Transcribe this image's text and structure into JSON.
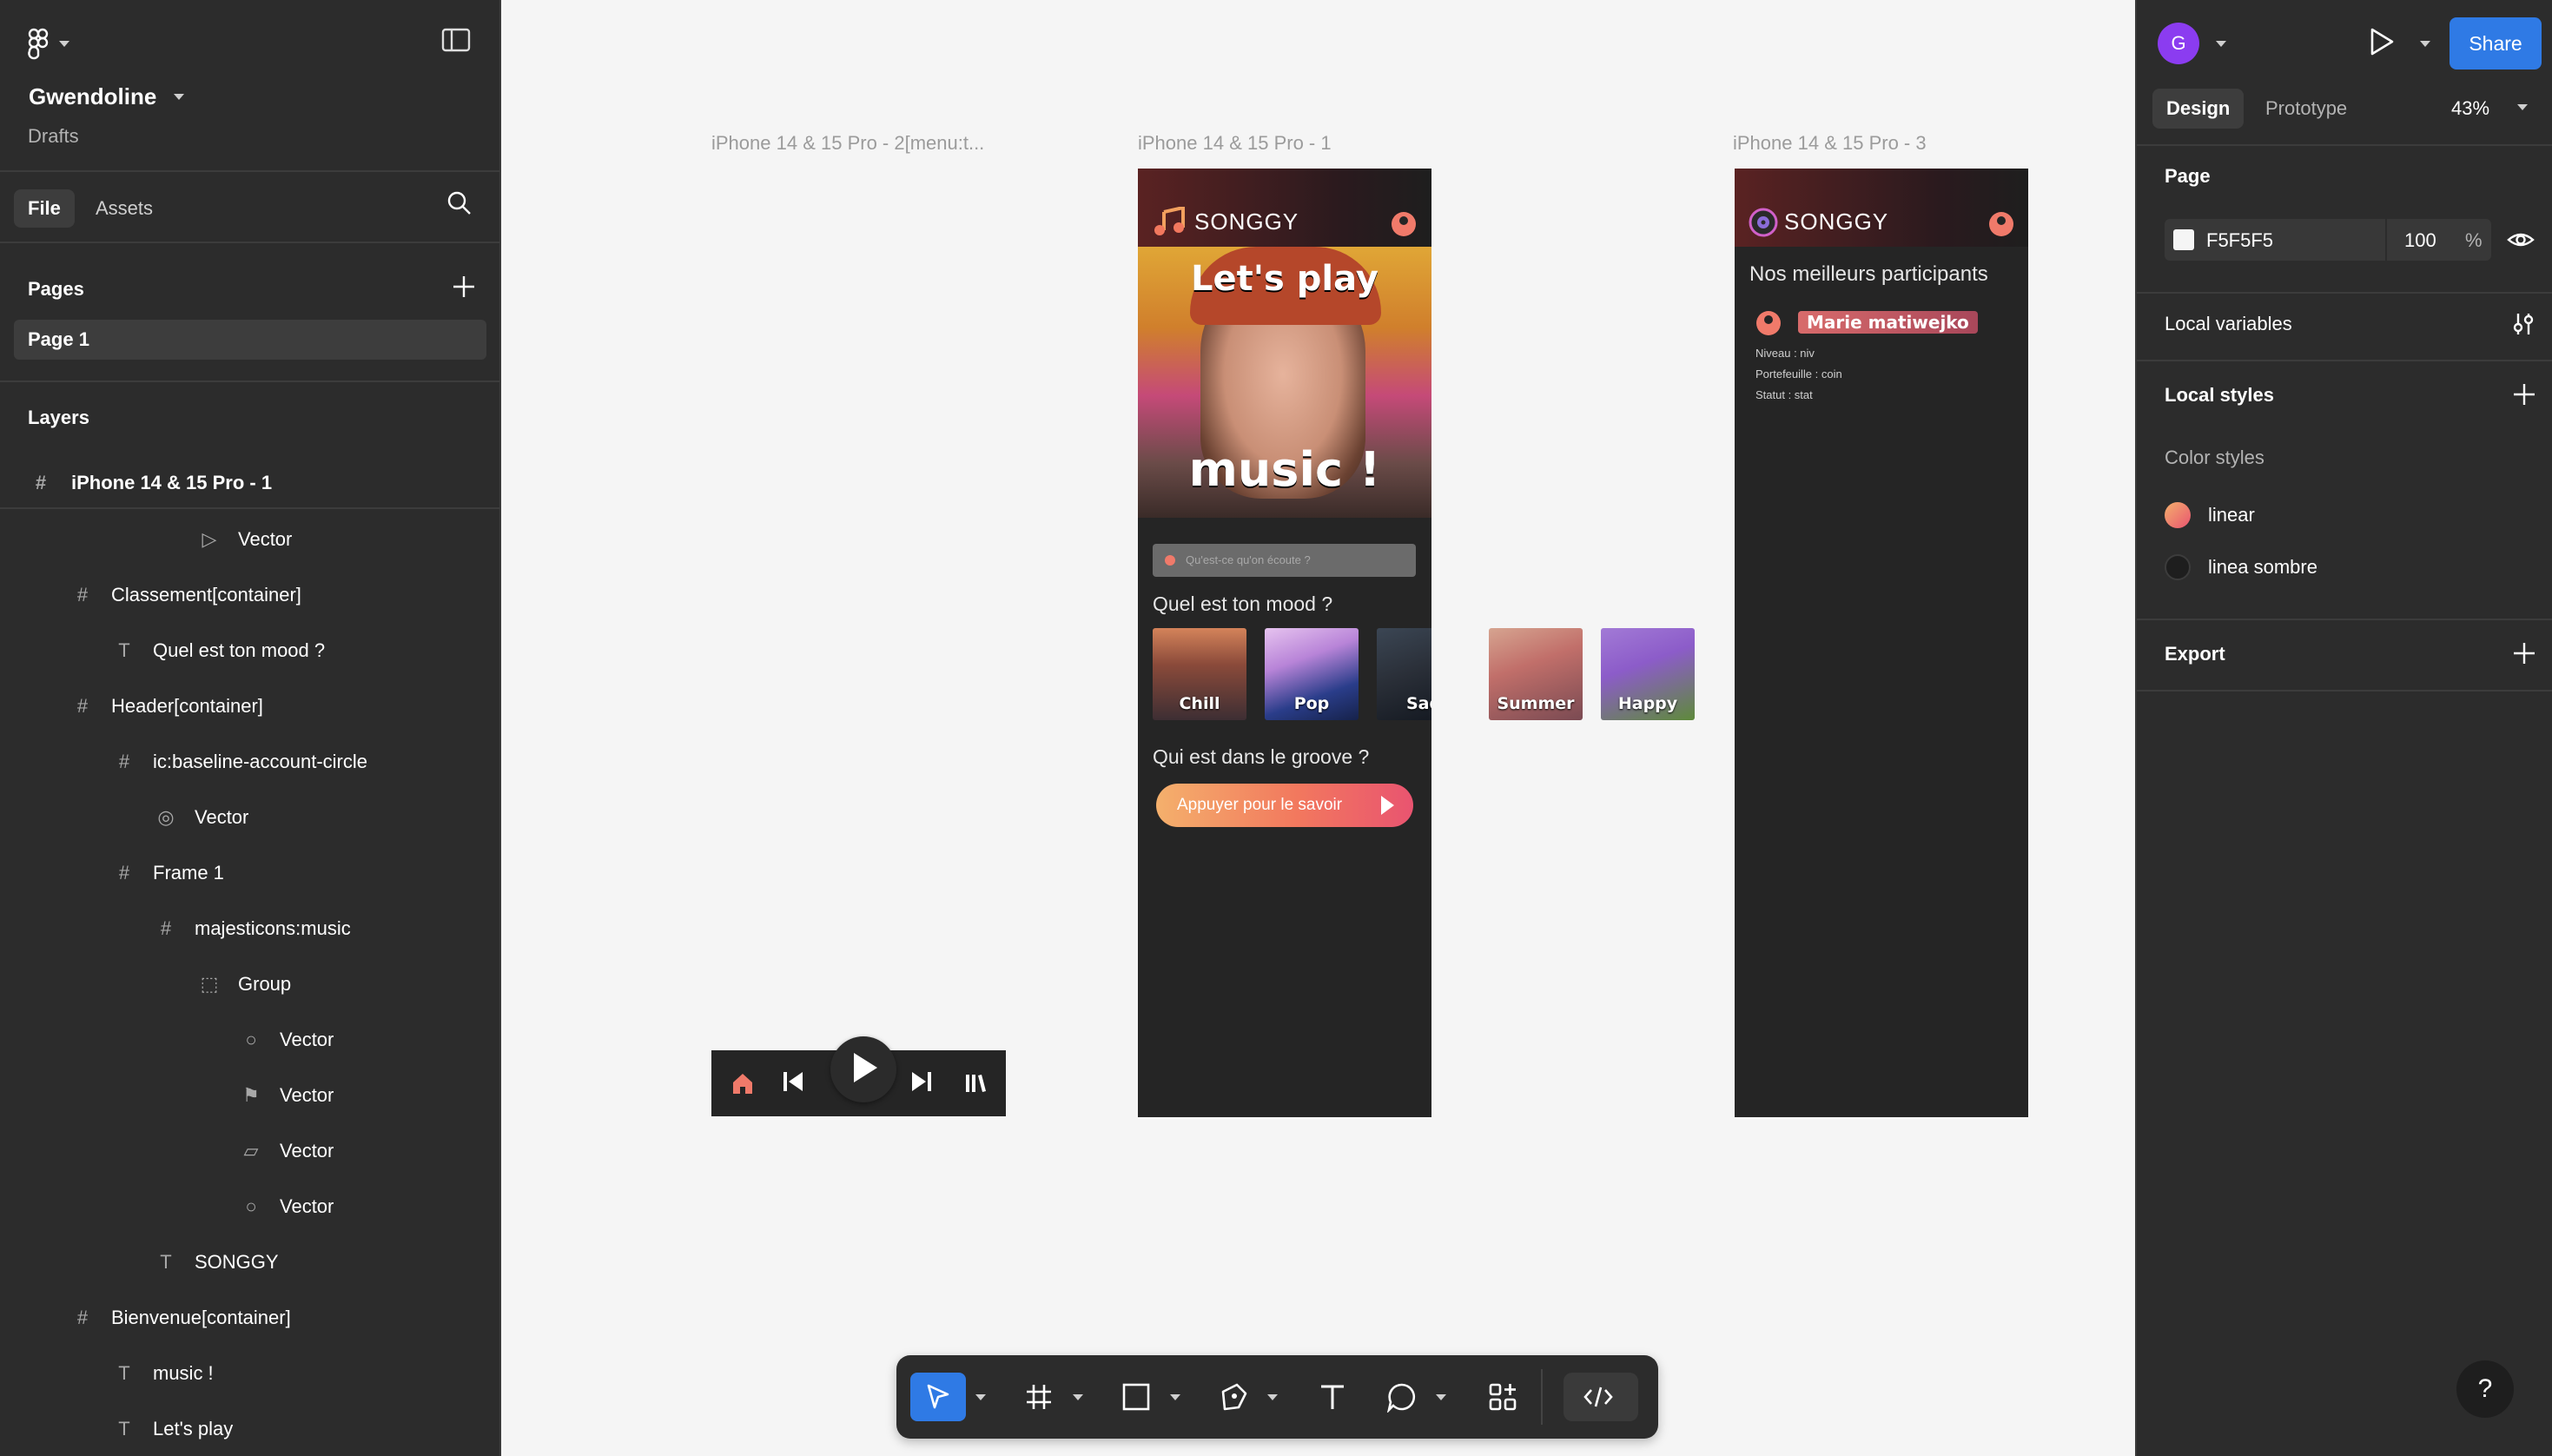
{
  "project": {
    "name": "Gwendoline",
    "location": "Drafts"
  },
  "left_tabs": {
    "file": "File",
    "assets": "Assets"
  },
  "pages": {
    "title": "Pages",
    "items": [
      "Page 1"
    ]
  },
  "layers": {
    "title": "Layers",
    "root": "iPhone 14 & 15 Pro - 1",
    "items": [
      {
        "label": "Vector",
        "icon": "play-vector-icon"
      },
      {
        "label": "Classement[container]",
        "icon": "frame-icon"
      },
      {
        "label": "Quel est ton mood ?",
        "icon": "text-icon"
      },
      {
        "label": "Header[container]",
        "icon": "frame-icon"
      },
      {
        "label": "ic:baseline-account-circle",
        "icon": "frame-icon"
      },
      {
        "label": "Vector",
        "icon": "account-vector-icon"
      },
      {
        "label": "Frame 1",
        "icon": "frame-icon"
      },
      {
        "label": "majesticons:music",
        "icon": "frame-icon"
      },
      {
        "label": "Group",
        "icon": "group-icon"
      },
      {
        "label": "Vector",
        "icon": "ellipse-icon"
      },
      {
        "label": "Vector",
        "icon": "flag-vector-icon"
      },
      {
        "label": "Vector",
        "icon": "line-vector-icon"
      },
      {
        "label": "Vector",
        "icon": "ellipse-icon"
      },
      {
        "label": "SONGGY",
        "icon": "text-icon"
      },
      {
        "label": "Bienvenue[container]",
        "icon": "frame-icon"
      },
      {
        "label": "music !",
        "icon": "text-icon"
      },
      {
        "label": "Let's play",
        "icon": "text-icon"
      }
    ]
  },
  "canvas": {
    "frame_labels": [
      "iPhone 14 & 15 Pro - 2[menu:t...",
      "iPhone 14 & 15 Pro - 1",
      "iPhone 14 & 15 Pro - 3"
    ],
    "phone1": {
      "brand": "SONGGY",
      "hero_line1": "Let's play",
      "hero_line2": "music !",
      "search_placeholder": "Qu'est-ce qu'on écoute ?",
      "mood_title": "Quel est ton mood ?",
      "moods": [
        "Chill",
        "Pop",
        "Sad",
        "Summer",
        "Happy"
      ],
      "groove_title": "Qui est dans le groove ?",
      "cta": "Appuyer pour le savoir"
    },
    "phone3": {
      "brand": "SONGGY",
      "title": "Nos meilleurs participants",
      "name": "Marie matiwejko",
      "level": "Niveau : niv",
      "wallet": "Portefeuille : coin",
      "status": "Statut : stat"
    }
  },
  "right_panel": {
    "avatar_letter": "G",
    "share": "Share",
    "tabs": {
      "design": "Design",
      "prototype": "Prototype"
    },
    "zoom": "43%",
    "page_section": "Page",
    "bg_hex": "F5F5F5",
    "bg_opacity": "100",
    "percent_sign": "%",
    "local_variables": "Local variables",
    "local_styles": "Local styles",
    "color_styles": "Color styles",
    "styles": [
      {
        "name": "linear",
        "color": "#f2785e"
      },
      {
        "name": "linea sombre",
        "color": "#1e1e1e"
      }
    ],
    "export": "Export",
    "help": "?"
  },
  "colors": {
    "accent": "#2f7ae5",
    "panel": "#2c2c2c",
    "canvas": "#f5f5f5",
    "phone_bg": "#252525",
    "coral": "#f07a6a"
  }
}
